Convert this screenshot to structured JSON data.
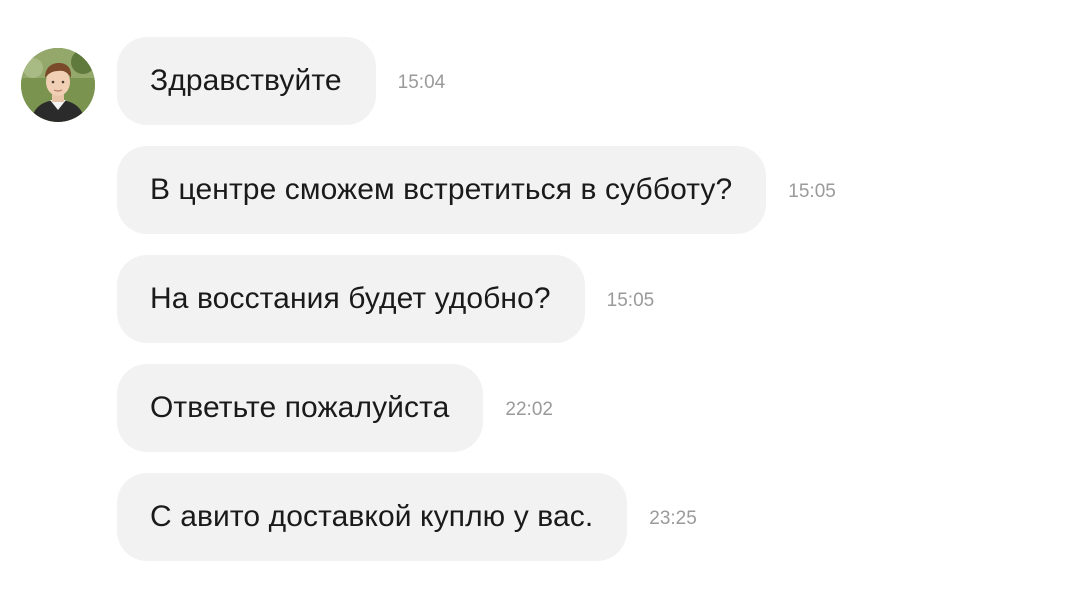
{
  "contact": {
    "avatar_icon": "user-avatar-photo"
  },
  "messages": [
    {
      "text": "Здравствуйте",
      "time": "15:04"
    },
    {
      "text": "В центре сможем встретиться в субботу?",
      "time": "15:05"
    },
    {
      "text": "На восстания будет удобно?",
      "time": "15:05"
    },
    {
      "text": "Ответьте пожалуйста",
      "time": "22:02"
    },
    {
      "text": "С авито доставкой куплю у вас.",
      "time": "23:25"
    }
  ],
  "colors": {
    "bubble_background": "#f2f2f2",
    "text": "#1a1a1a",
    "timestamp": "#9a9a9a",
    "page_background": "#ffffff"
  }
}
